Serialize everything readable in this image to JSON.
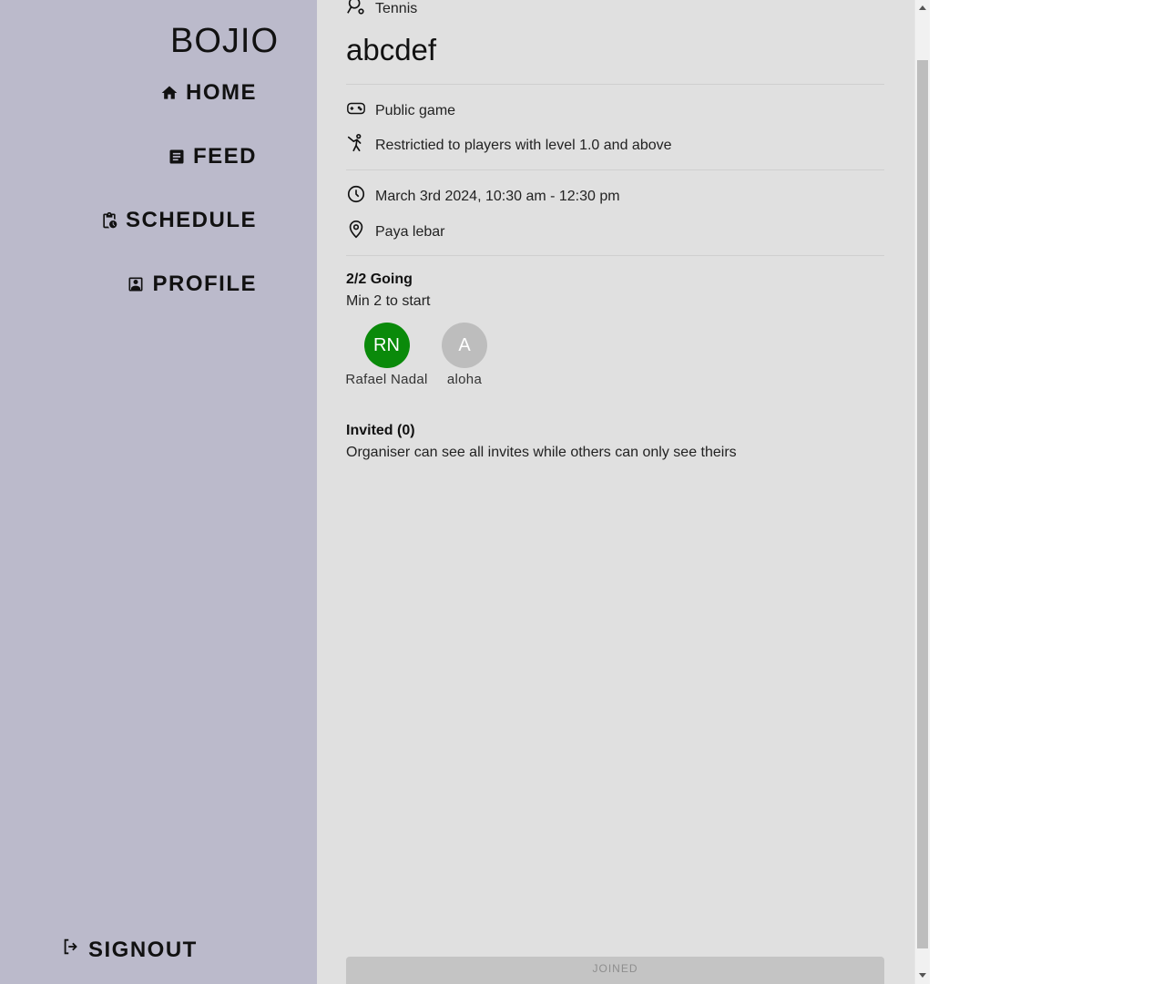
{
  "sidebar": {
    "brand": "BOJIO",
    "nav": {
      "home": "HOME",
      "feed": "FEED",
      "schedule": "SCHEDULE",
      "profile": "PROFILE"
    },
    "signout": "SIGNOUT"
  },
  "game": {
    "sport": "Tennis",
    "title": "abcdef",
    "visibility": "Public game",
    "restriction": "Restrictied to players with level 1.0 and above",
    "datetime": "March 3rd 2024, 10:30 am - 12:30 pm",
    "location": "Paya lebar",
    "going": {
      "title": "2/2 Going",
      "subtitle": "Min 2 to start",
      "participants": [
        {
          "initials": "RN",
          "name": "Rafael Nadal",
          "color": "#0a8a0a"
        },
        {
          "initials": "A",
          "name": "aloha",
          "color": "#bdbdbd"
        }
      ]
    },
    "invited": {
      "title": "Invited (0)",
      "subtitle": "Organiser can see all invites while others can only see theirs"
    },
    "action_label": "JOINED"
  }
}
